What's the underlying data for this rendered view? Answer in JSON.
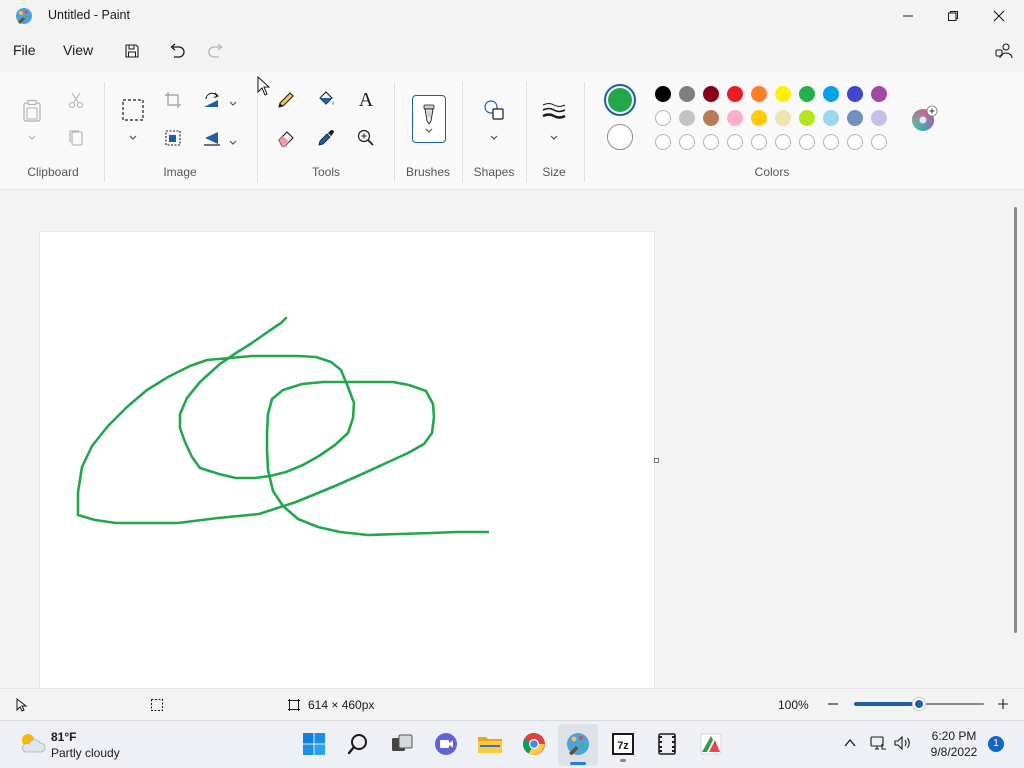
{
  "window": {
    "title": "Untitled - Paint"
  },
  "menu": {
    "file": "File",
    "view": "View"
  },
  "ribbon": {
    "groups": {
      "clipboard": "Clipboard",
      "image": "Image",
      "tools": "Tools",
      "brushes": "Brushes",
      "shapes": "Shapes",
      "size": "Size",
      "colors": "Colors"
    },
    "tools_text_glyph": "A"
  },
  "colors": {
    "primary": "#22a74a",
    "secondary": "#ffffff",
    "palette_row1": [
      "#000000",
      "#7f7f7f",
      "#880015",
      "#ed1c24",
      "#ff7f27",
      "#fff200",
      "#22b14c",
      "#00a2e8",
      "#3f48cc",
      "#a349a4"
    ],
    "palette_row2": [
      "#ffffff",
      "#c3c3c3",
      "#b97a57",
      "#ffaec9",
      "#ffc90e",
      "#efe4b0",
      "#b5e61d",
      "#99d9ea",
      "#7092be",
      "#c8bfe7"
    ],
    "palette_row3_count": 10
  },
  "canvas": {
    "stroke_color": "#22a74a"
  },
  "status": {
    "dimensions": "614 × 460px",
    "zoom": "100%",
    "zoom_level_fraction": 0.5
  },
  "taskbar": {
    "weather_temp": "81°F",
    "weather_desc": "Partly cloudy",
    "time": "6:20 PM",
    "date": "9/8/2022",
    "notification_count": "1"
  }
}
